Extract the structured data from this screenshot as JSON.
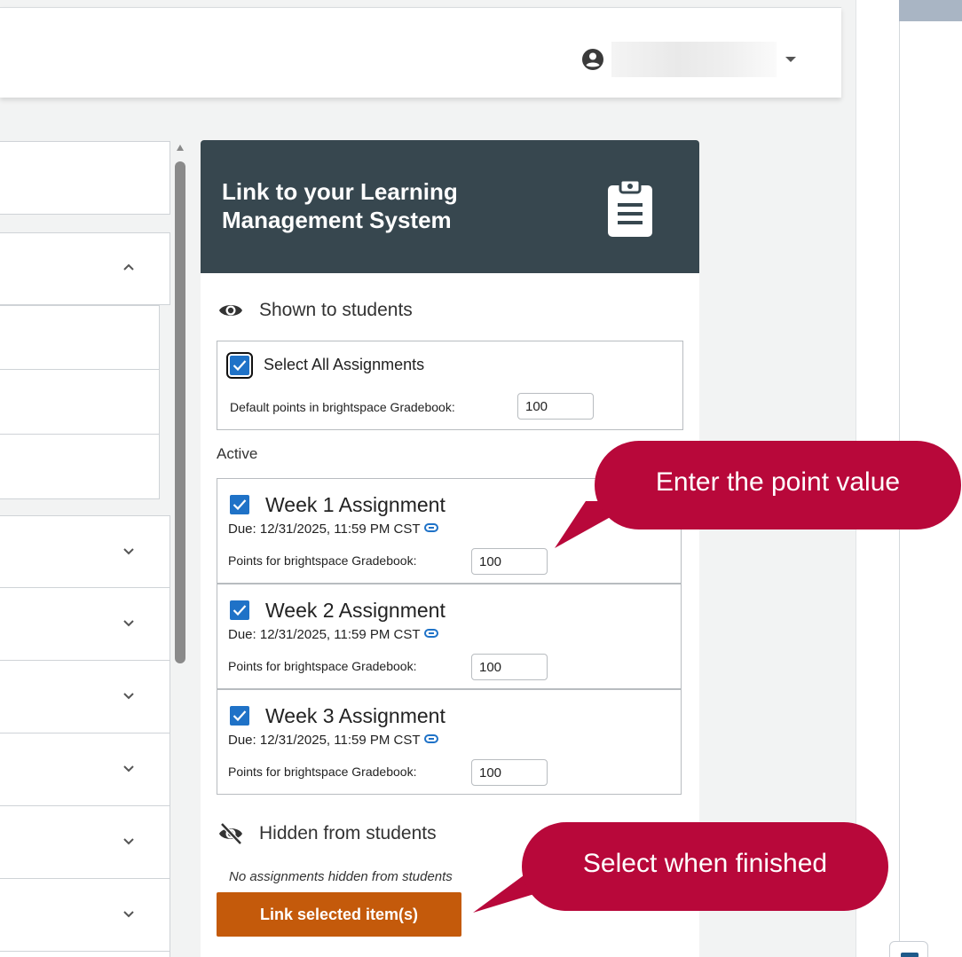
{
  "header": {
    "user_name": "",
    "user_menu_icon": "account-circle-icon"
  },
  "list": {
    "rows": [
      {
        "chevron": "none"
      },
      {
        "chevron": "up"
      },
      {
        "chevron": "none"
      },
      {
        "chevron": "none"
      },
      {
        "chevron": "none"
      },
      {
        "chevron": "down"
      },
      {
        "chevron": "down"
      },
      {
        "chevron": "down"
      },
      {
        "chevron": "down"
      },
      {
        "chevron": "down"
      },
      {
        "chevron": "down"
      }
    ]
  },
  "panel": {
    "title": "Link to your Learning Management System",
    "header_icon": "clipboard-icon",
    "shown": {
      "label": "Shown to students",
      "icon": "eye-icon",
      "select_all_label": "Select All Assignments",
      "default_points_label": "Default points in brightspace Gradebook:",
      "default_points_value": "100"
    },
    "active_label": "Active",
    "assignments": [
      {
        "name": "Week 1 Assignment",
        "due": "Due: 12/31/2025, 11:59 PM CST",
        "points_label": "Points for brightspace Gradebook:",
        "points": "100",
        "checked": true
      },
      {
        "name": "Week 2 Assignment",
        "due": "Due: 12/31/2025, 11:59 PM CST",
        "points_label": "Points for brightspace Gradebook:",
        "points": "100",
        "checked": true
      },
      {
        "name": "Week 3 Assignment",
        "due": "Due: 12/31/2025, 11:59 PM CST",
        "points_label": "Points for brightspace Gradebook:",
        "points": "100",
        "checked": true
      }
    ],
    "hidden": {
      "label": "Hidden from students",
      "icon": "eye-slash-icon",
      "empty_text": "No assignments hidden from students"
    },
    "link_button": "Link selected item(s)"
  },
  "callouts": {
    "point_value": "Enter the point value",
    "finished": "Select when finished"
  },
  "colors": {
    "panel_header": "#37474f",
    "checkbox": "#1f72c7",
    "link_button": "#c45a0b",
    "callout": "#b8083a"
  }
}
